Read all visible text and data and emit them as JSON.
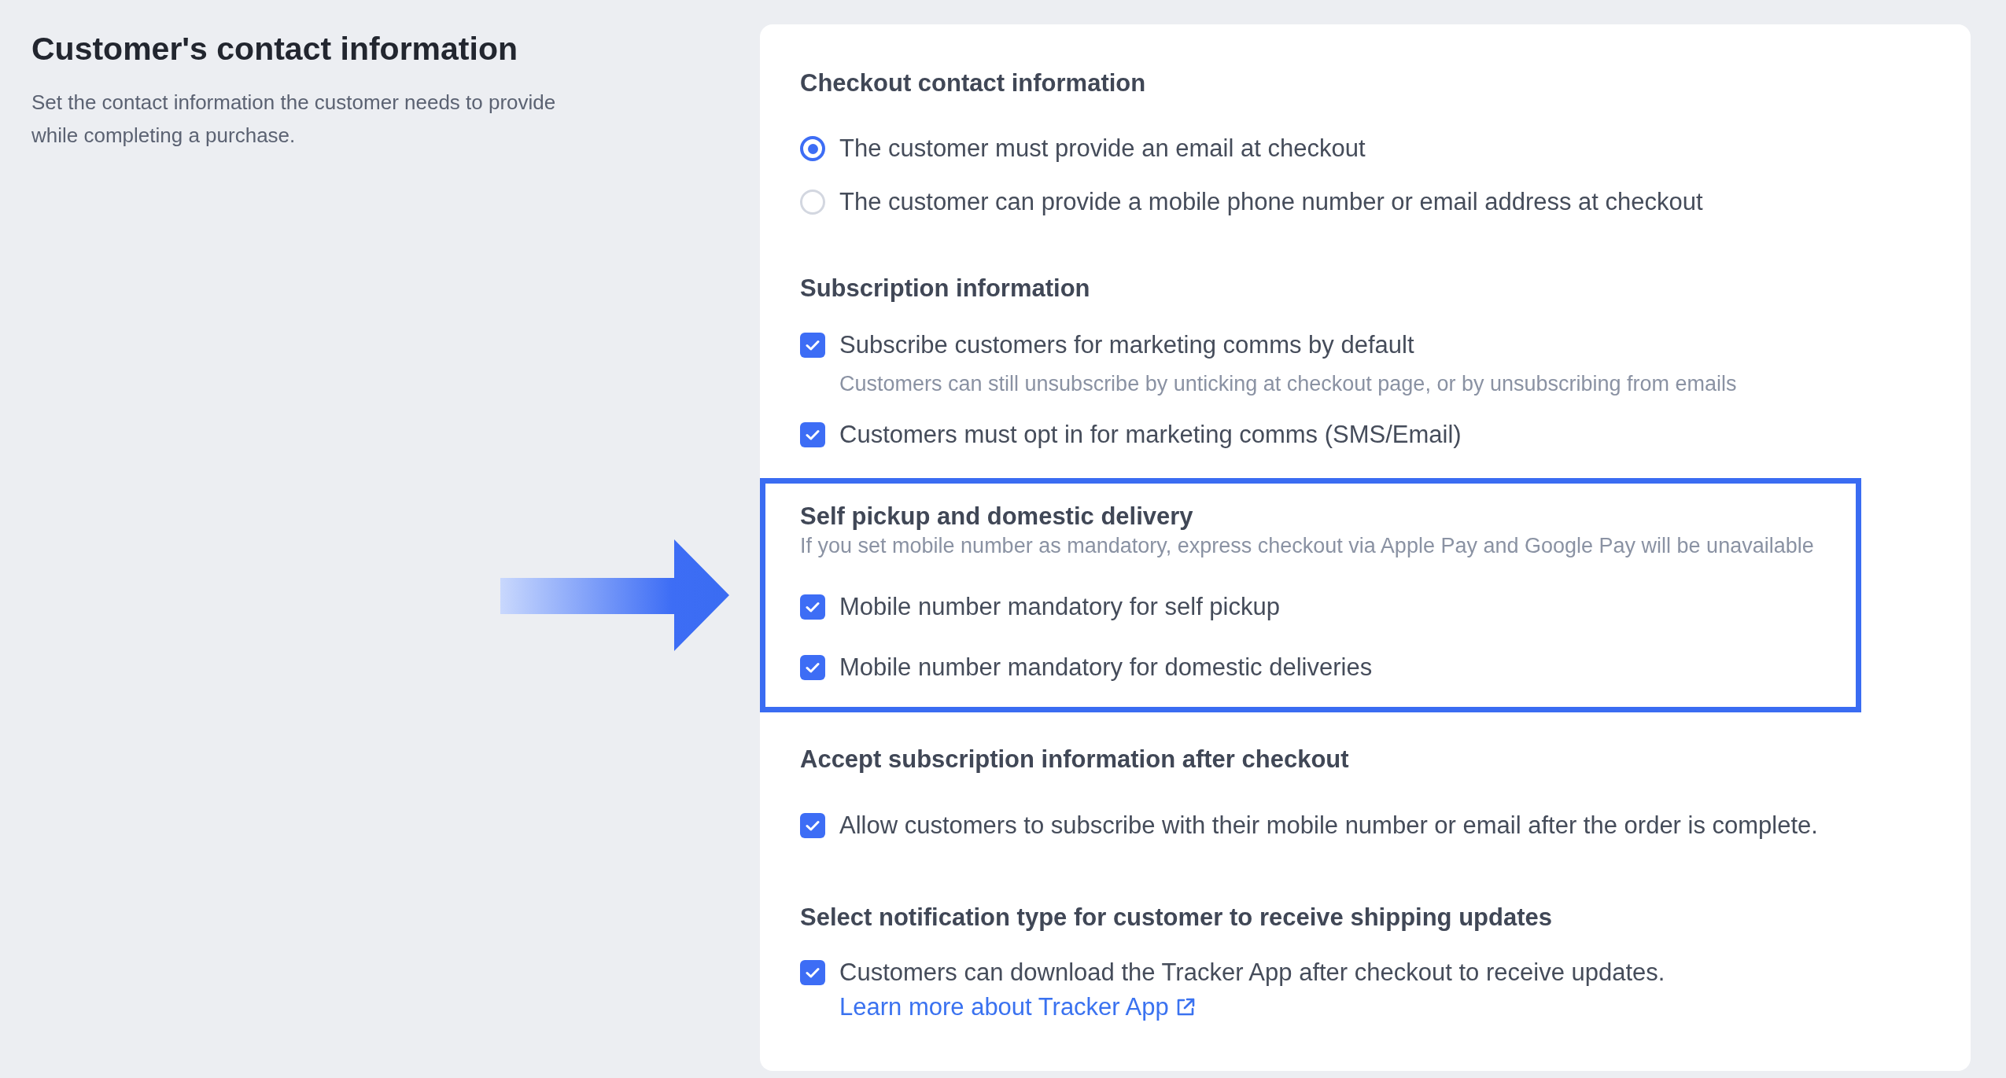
{
  "page": {
    "title": "Customer's contact information",
    "description": "Set the contact information the customer needs to provide while completing a purchase."
  },
  "sections": [
    {
      "kind": "radio",
      "heading": "Checkout contact information",
      "highlighted": false,
      "items": [
        {
          "label": "The customer must provide an email at checkout",
          "selected": true
        },
        {
          "label": "The customer can provide a mobile phone number or email address at checkout",
          "selected": false
        }
      ]
    },
    {
      "kind": "checkbox",
      "heading": "Subscription information",
      "highlighted": false,
      "items": [
        {
          "label": "Subscribe customers for marketing comms by default",
          "checked": true,
          "note": "Customers can still unsubscribe by unticking at checkout page, or by unsubscribing from emails"
        },
        {
          "label": "Customers must opt in for marketing comms (SMS/Email)",
          "checked": true
        }
      ]
    },
    {
      "kind": "checkbox",
      "heading": "Self pickup and domestic delivery",
      "note": "If you set mobile number as mandatory, express checkout via Apple Pay and Google Pay will be unavailable",
      "highlighted": true,
      "items": [
        {
          "label": "Mobile number mandatory for self pickup",
          "checked": true
        },
        {
          "label": "Mobile number mandatory for domestic deliveries",
          "checked": true
        }
      ]
    },
    {
      "kind": "checkbox",
      "heading": "Accept subscription information after checkout",
      "highlighted": false,
      "items": [
        {
          "label": "Allow customers to subscribe with their mobile number or email after the order is complete.",
          "checked": true
        }
      ]
    },
    {
      "kind": "checkbox",
      "heading": "Select notification type for customer to receive shipping updates",
      "highlighted": false,
      "items": [
        {
          "label": "Customers can download the Tracker App after checkout to receive updates.",
          "checked": true,
          "link": "Learn more about Tracker App"
        }
      ]
    }
  ]
}
